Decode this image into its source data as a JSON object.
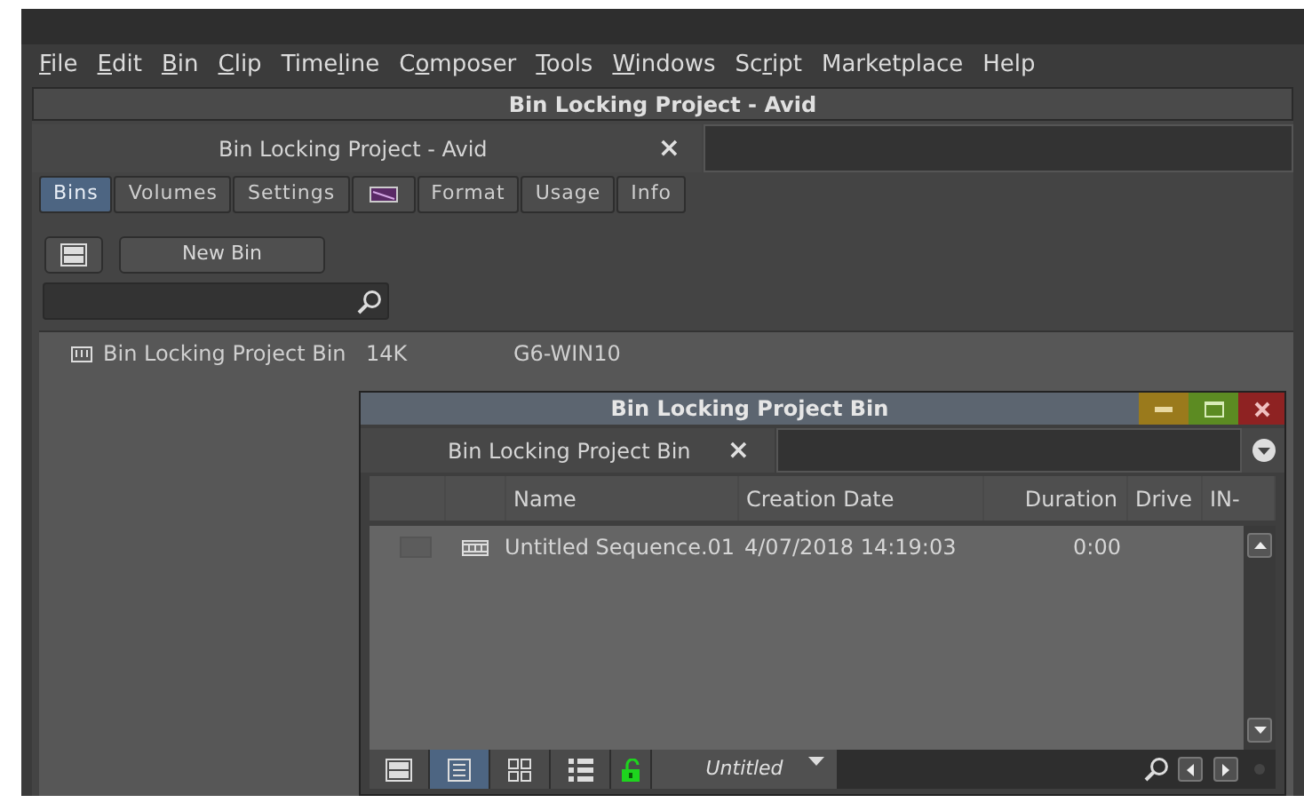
{
  "menu": [
    {
      "underlined": "F",
      "after": "ile"
    },
    {
      "underlined": "E",
      "after": "dit"
    },
    {
      "underlined": "B",
      "after": "in"
    },
    {
      "underlined": "C",
      "after": "lip"
    },
    {
      "before": "Time",
      "underlined": "l",
      "after": "ine"
    },
    {
      "before": "C",
      "underlined": "o",
      "after": "mposer"
    },
    {
      "underlined": "T",
      "after": "ools"
    },
    {
      "underlined": "W",
      "after": "indows"
    },
    {
      "before": "Sc",
      "underlined": "r",
      "after": "ipt"
    },
    {
      "label": "Marketplace"
    },
    {
      "label": "Help"
    }
  ],
  "project_window": {
    "title": "Bin Locking Project - Avid",
    "tab": {
      "label": "Bin Locking Project - Avid",
      "close": "×"
    },
    "tabs": [
      {
        "kind": "text",
        "label": "Bins",
        "selected": true
      },
      {
        "kind": "text",
        "label": "Volumes",
        "selected": false
      },
      {
        "kind": "text",
        "label": "Settings",
        "selected": false
      },
      {
        "kind": "swatch",
        "selected": false
      },
      {
        "kind": "text",
        "label": "Format",
        "selected": false
      },
      {
        "kind": "text",
        "label": "Usage",
        "selected": false
      },
      {
        "kind": "text",
        "label": "Info",
        "selected": false
      }
    ],
    "new_bin_button": "New Bin",
    "bins": [
      {
        "name": "Bin Locking Project Bin",
        "size": "14K",
        "host": "G6-WIN10"
      }
    ]
  },
  "bin_window": {
    "title": "Bin Locking Project Bin",
    "tab": {
      "label": "Bin Locking Project Bin",
      "close": "×"
    },
    "columns": [
      "Name",
      "Creation Date",
      "Duration",
      "Drive",
      "IN-"
    ],
    "rows": [
      {
        "name": "Untitled Sequence.01",
        "creation_date": "4/07/2018 14:19:03",
        "duration": "0:00"
      }
    ],
    "view_buttons": [
      {
        "kind": "toggle",
        "selected": false
      },
      {
        "kind": "text",
        "selected": true
      },
      {
        "kind": "frame",
        "selected": false
      },
      {
        "kind": "script",
        "selected": false
      }
    ],
    "locked": false,
    "view_name": "Untitled"
  }
}
